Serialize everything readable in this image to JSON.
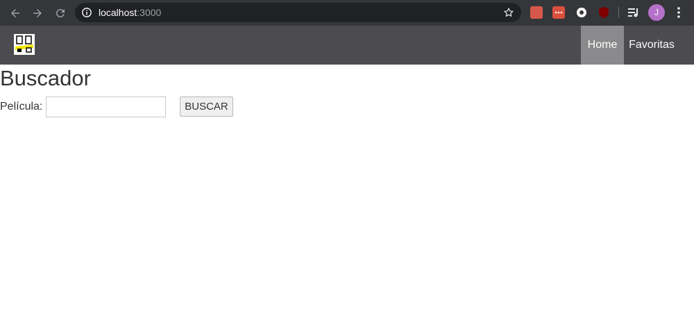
{
  "browser": {
    "url_host": "localhost",
    "url_port": ":3000",
    "avatar_initial": "J",
    "extension_icons": [
      "ext-camera-icon",
      "ext-dots-icon",
      "ext-circle-icon",
      "ext-ublock-icon"
    ],
    "colors": {
      "toolbar": "#35363a",
      "omnibox": "#202124",
      "avatar": "#b571c9"
    }
  },
  "navbar": {
    "home_label": "Home",
    "favorites_label": "Favoritas",
    "colors": {
      "background": "#4b4b50",
      "active": "#8a8a8c"
    }
  },
  "main": {
    "title": "Buscador",
    "movie_label": "Película:",
    "movie_value": "",
    "search_button_label": "BUSCAR"
  }
}
